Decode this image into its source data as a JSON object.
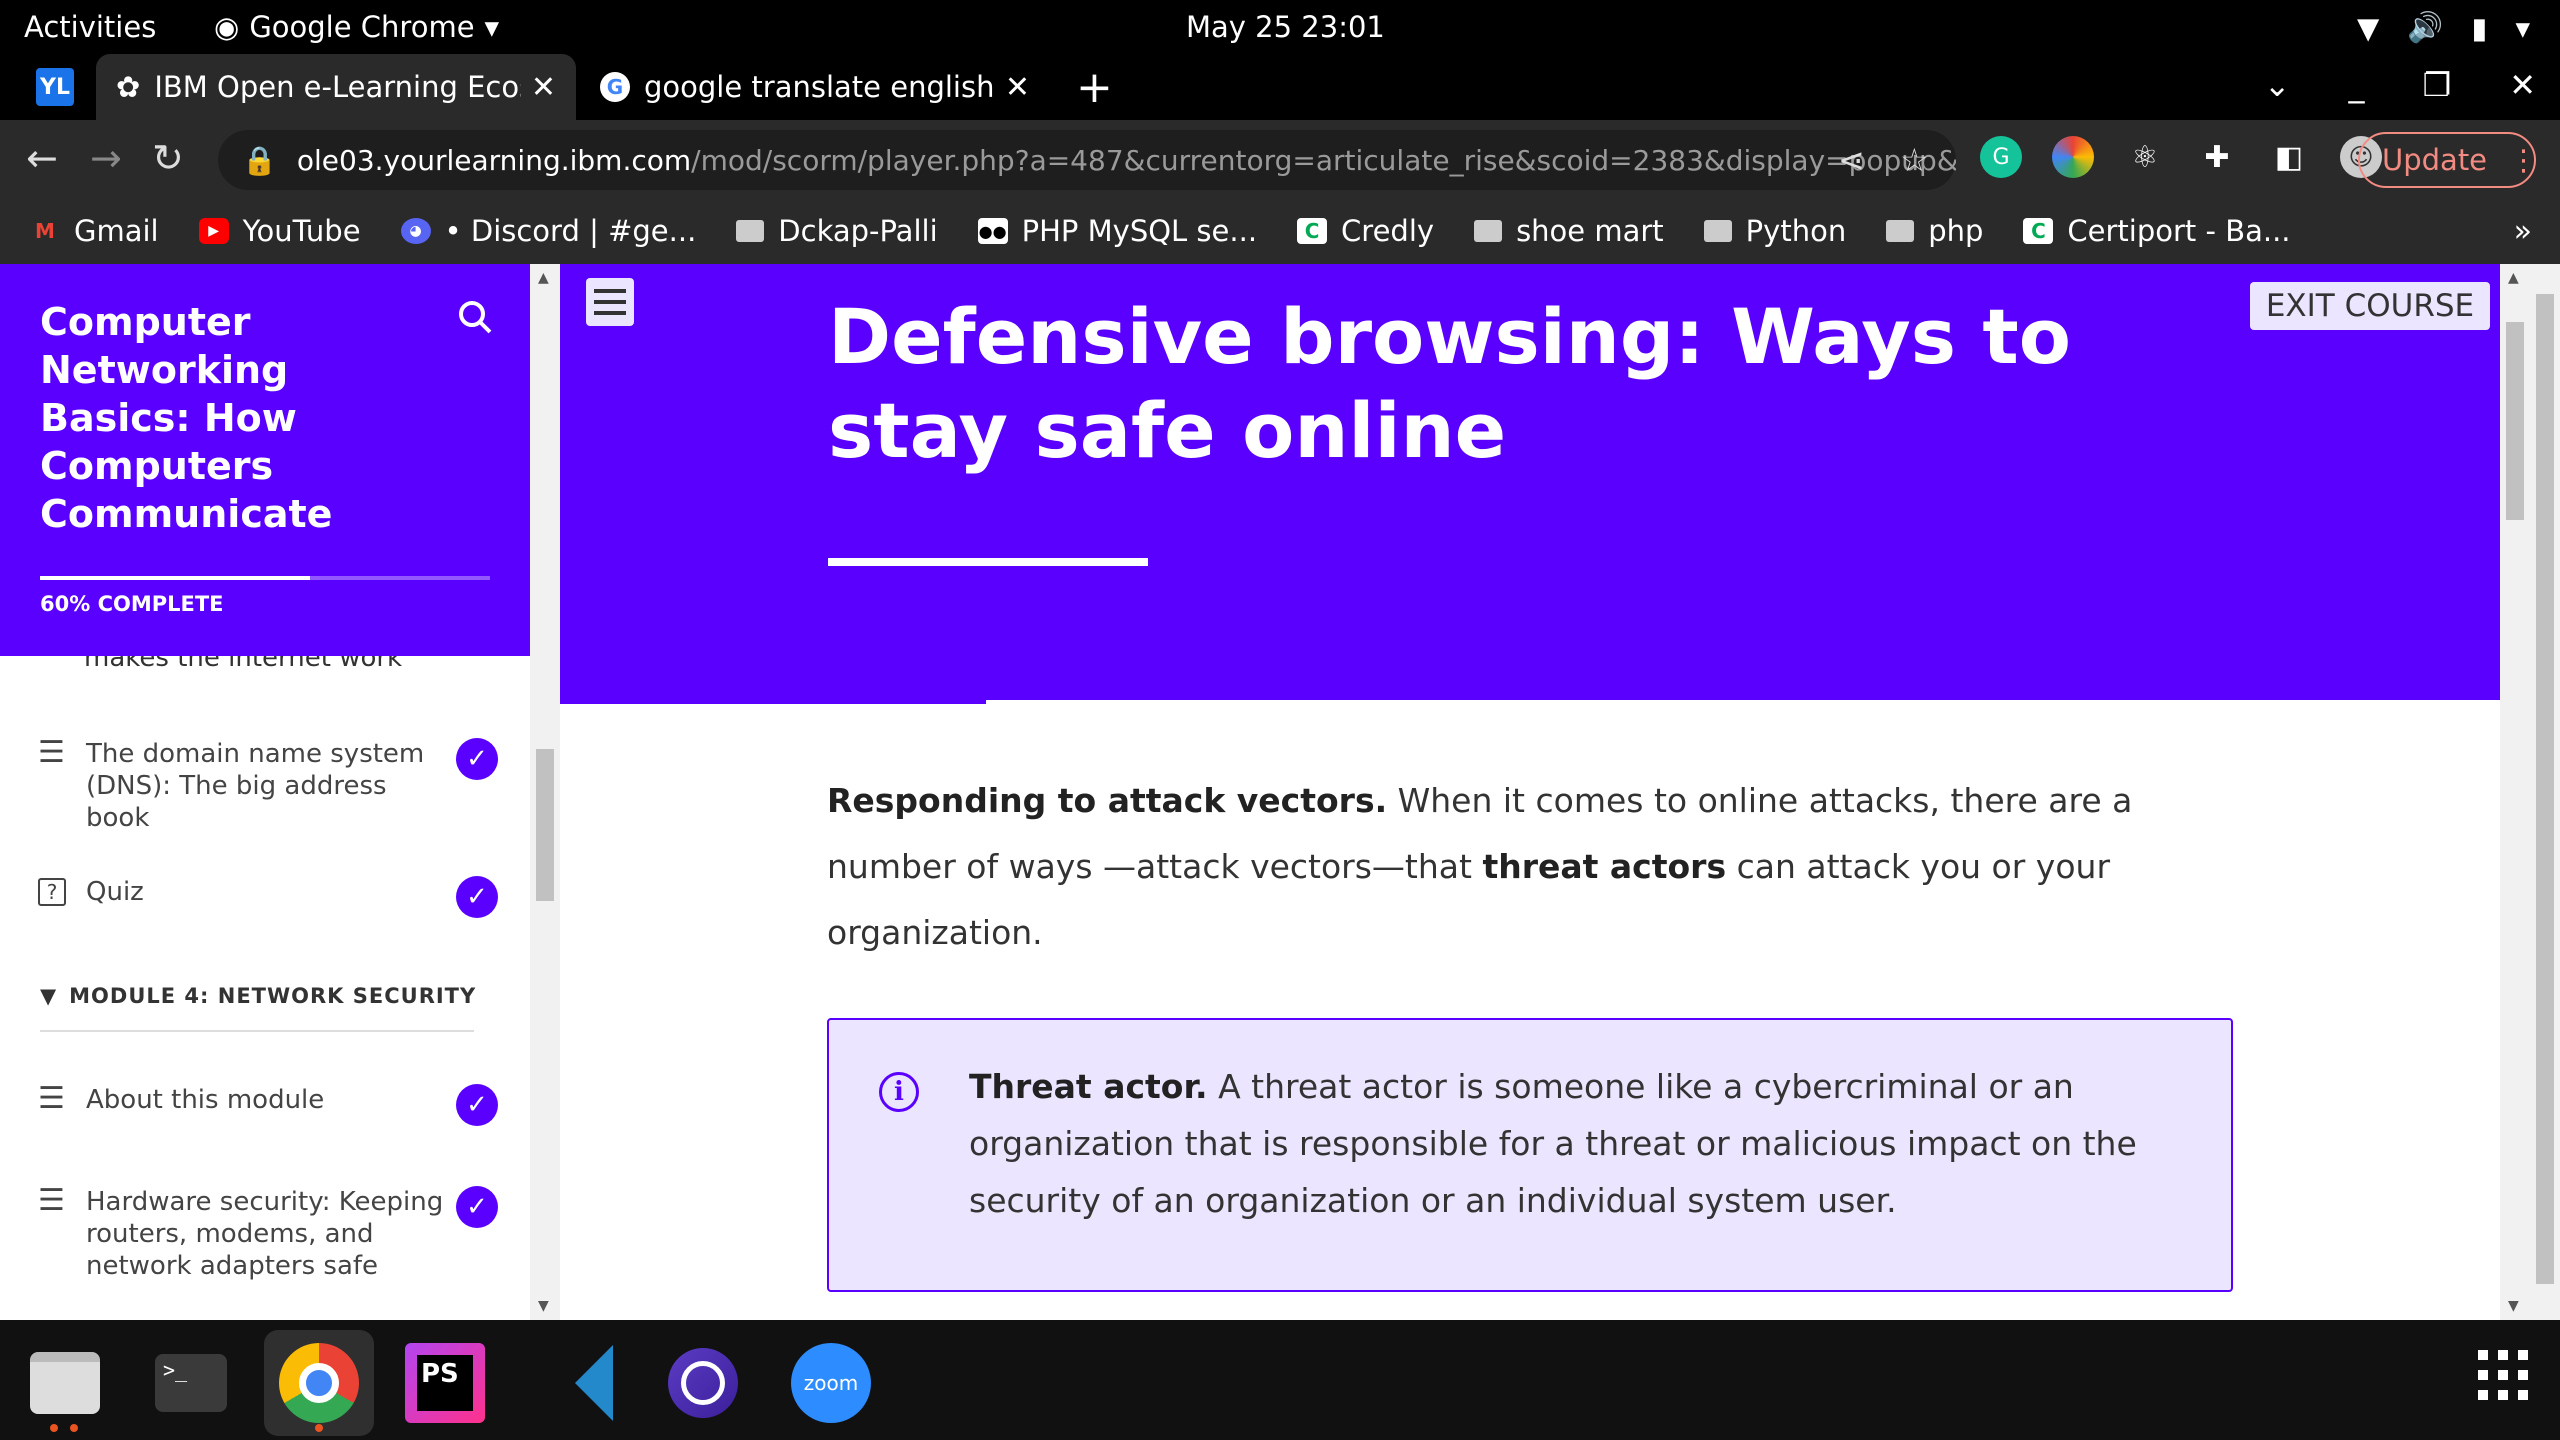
{
  "system": {
    "activities": "Activities",
    "app_name": "Google Chrome",
    "clock": "May 25  23:01"
  },
  "browser": {
    "tabs": [
      {
        "title": "IBM Open e-Learning Ecos",
        "active": true
      },
      {
        "title": "google translate english t",
        "active": false
      }
    ],
    "url_host": "ole03.yourlearning.ibm.com",
    "url_path": "/mod/scorm/player.php?a=487&currentorg=articulate_rise&scoid=2383&display=popup&...",
    "update_label": "Update",
    "bookmarks": [
      {
        "label": "Gmail",
        "icon": "gmail-icon"
      },
      {
        "label": "YouTube",
        "icon": "youtube-icon"
      },
      {
        "label": "• Discord | #ge...",
        "icon": "discord-icon"
      },
      {
        "label": "Dckap-Palli",
        "icon": "folder-icon"
      },
      {
        "label": "PHP MySQL se...",
        "icon": "medium-icon"
      },
      {
        "label": "Credly",
        "icon": "credly-icon"
      },
      {
        "label": "shoe mart",
        "icon": "folder-icon"
      },
      {
        "label": "Python",
        "icon": "folder-icon"
      },
      {
        "label": "php",
        "icon": "folder-icon"
      },
      {
        "label": "Certiport - Ba...",
        "icon": "credly-icon"
      }
    ]
  },
  "course": {
    "title": "Computer Networking Basics: How Computers Communicate",
    "progress_fraction": 0.6,
    "progress_label": "60% COMPLETE",
    "cut_item": "makes the internet work",
    "items": [
      {
        "label": "The domain name system (DNS): The big address book",
        "completed": true
      },
      {
        "label": "Quiz",
        "completed": true
      },
      {
        "label": "About this module",
        "completed": true
      },
      {
        "label": "Hardware security: Keeping routers, modems, and network adapters safe",
        "completed": true
      }
    ],
    "module_label": "MODULE 4: NETWORK SECURITY"
  },
  "lesson": {
    "title": "Defensive browsing: Ways to stay safe online",
    "exit_label": "EXIT COURSE",
    "para_lead": "Responding to attack vectors.",
    "para_1": " When it comes to online attacks, there are a number of ways —attack vectors—that ",
    "para_bold": "threat actors",
    "para_2": " can attack you or your organization.",
    "note_lead": "Threat actor.",
    "note_text": " A threat actor is someone like a cybercriminal or an organization that is responsible for a threat or malicious impact on the security of an organization or an individual system user."
  },
  "colors": {
    "accent": "#5a00ff",
    "accent_light": "#ebe5ff"
  }
}
